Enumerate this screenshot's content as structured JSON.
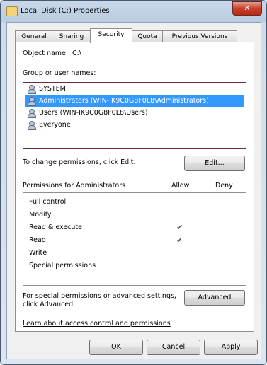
{
  "window": {
    "title": "Local Disk (C:) Properties",
    "close_label": "✕"
  },
  "tabs": [
    {
      "label": "General"
    },
    {
      "label": "Sharing"
    },
    {
      "label": "Security"
    },
    {
      "label": "Quota"
    },
    {
      "label": "Previous Versions"
    }
  ],
  "security": {
    "object_name_label": "Object name:",
    "object_name_value": "C:\\",
    "groups_label": "Group or user names:",
    "groups": [
      {
        "name": "SYSTEM",
        "icon": "user-icon"
      },
      {
        "name": "Administrators (WIN-IK9C0G8F0L8\\Administrators)",
        "icon": "user-icon",
        "selected": true
      },
      {
        "name": "Users (WIN-IK9C0G8F0L8\\Users)",
        "icon": "user-icon"
      },
      {
        "name": "Everyone",
        "icon": "user-icon"
      }
    ],
    "change_permissions_label": "To change permissions, click Edit.",
    "edit_button": "Edit...",
    "permissions_for_label": "Permissions for Administrators",
    "allow_label": "Allow",
    "deny_label": "Deny",
    "permissions": [
      {
        "name": "Full control",
        "allow": false
      },
      {
        "name": "Modify",
        "allow": false
      },
      {
        "name": "Read & execute",
        "allow": true
      },
      {
        "name": "Read",
        "allow": true
      },
      {
        "name": "Write",
        "allow": false
      },
      {
        "name": "Special permissions",
        "allow": false
      }
    ],
    "check_glyph": "✔",
    "special_label": "For special permissions or advanced settings, click Advanced.",
    "advanced_button": "Advanced",
    "learn_link": "Learn about access control and permissions"
  },
  "buttons": {
    "ok": "OK",
    "cancel": "Cancel",
    "apply": "Apply"
  }
}
